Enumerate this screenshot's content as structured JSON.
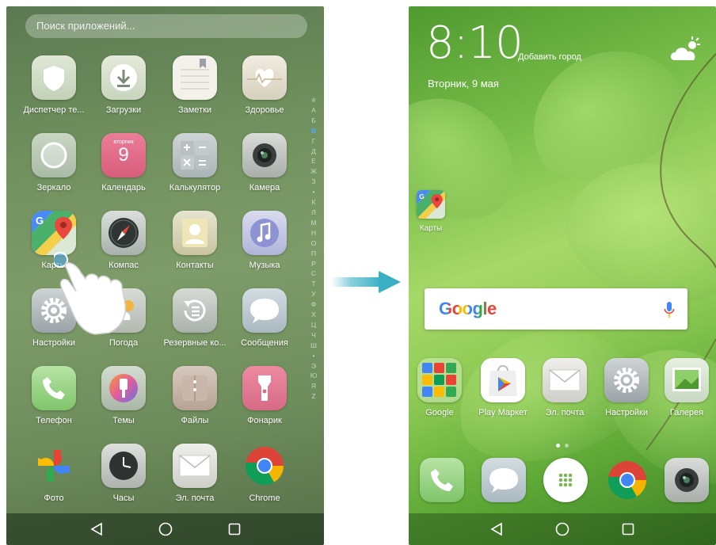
{
  "drawer": {
    "search_placeholder": "Поиск приложений...",
    "apps": [
      {
        "label": "Диспетчер те...",
        "icon": "shield-icon"
      },
      {
        "label": "Загрузки",
        "icon": "download-icon"
      },
      {
        "label": "Заметки",
        "icon": "notes-icon"
      },
      {
        "label": "Здоровье",
        "icon": "heart-icon"
      },
      {
        "label": "Зеркало",
        "icon": "mirror-icon"
      },
      {
        "label": "Календарь",
        "icon": "calendar-icon",
        "day_name": "вторник",
        "day_number": "9"
      },
      {
        "label": "Калькулятор",
        "icon": "calculator-icon"
      },
      {
        "label": "Камера",
        "icon": "camera-icon"
      },
      {
        "label": "Карты",
        "icon": "maps-icon"
      },
      {
        "label": "Компас",
        "icon": "compass-icon"
      },
      {
        "label": "Контакты",
        "icon": "contacts-icon"
      },
      {
        "label": "Музыка",
        "icon": "music-icon"
      },
      {
        "label": "Настройки",
        "icon": "settings-icon"
      },
      {
        "label": "Погода",
        "icon": "weather-icon"
      },
      {
        "label": "Резервные ко...",
        "icon": "backup-icon"
      },
      {
        "label": "Сообщения",
        "icon": "messages-icon"
      },
      {
        "label": "Телефон",
        "icon": "phone-icon"
      },
      {
        "label": "Темы",
        "icon": "themes-icon"
      },
      {
        "label": "Файлы",
        "icon": "files-icon"
      },
      {
        "label": "Фонарик",
        "icon": "flashlight-icon"
      },
      {
        "label": "Фото",
        "icon": "photos-icon"
      },
      {
        "label": "Часы",
        "icon": "clock-icon"
      },
      {
        "label": "Эл. почта",
        "icon": "email-icon"
      },
      {
        "label": "Chrome",
        "icon": "chrome-icon"
      }
    ],
    "alphabet": [
      "#",
      "А",
      "Б",
      "В",
      "Г",
      "Д",
      "Е",
      "Ж",
      "З",
      "•",
      "К",
      "Л",
      "М",
      "Н",
      "О",
      "П",
      "Р",
      "С",
      "Т",
      "У",
      "Ф",
      "Х",
      "Ц",
      "Ч",
      "Ш",
      "•",
      "Э",
      "Ю",
      "Я",
      "Z"
    ],
    "alphabet_selected": "В"
  },
  "home": {
    "time": "8:10",
    "add_city": "Добавить город",
    "date": "Вторник, 9 мая",
    "maps_label": "Карты",
    "google_logo": "Google",
    "row_apps": [
      {
        "label": "Google",
        "icon": "google-folder-icon"
      },
      {
        "label": "Play Маркет",
        "icon": "play-store-icon"
      },
      {
        "label": "Эл. почта",
        "icon": "email-icon"
      },
      {
        "label": "Настройки",
        "icon": "settings-icon"
      },
      {
        "label": "Галерея",
        "icon": "gallery-icon"
      }
    ],
    "dock": [
      {
        "icon": "phone-icon"
      },
      {
        "icon": "messages-icon"
      },
      {
        "icon": "app-drawer-icon"
      },
      {
        "icon": "chrome-icon"
      },
      {
        "icon": "camera-icon"
      }
    ]
  },
  "colors": {
    "accent_teal": "#3bb0c4",
    "alphabet_selected": "#4fa8ff"
  }
}
